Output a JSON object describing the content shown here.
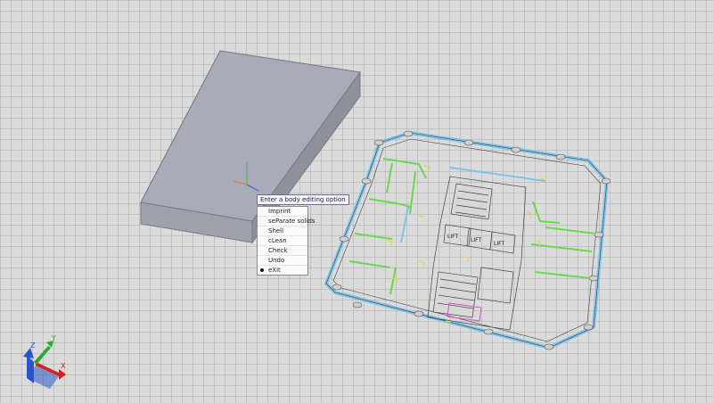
{
  "context_menu": {
    "title": "Enter a body editing option",
    "items": [
      {
        "label": "Imprint",
        "selected": false
      },
      {
        "label": "seParate solids",
        "selected": false
      },
      {
        "label": "Shell",
        "selected": false
      },
      {
        "label": "cLean",
        "selected": false
      },
      {
        "label": "Check",
        "selected": false
      },
      {
        "label": "Undo",
        "selected": false
      },
      {
        "label": "eXit",
        "selected": true
      }
    ]
  },
  "floorplan": {
    "lift_labels": [
      "LIFT",
      "LIFT",
      "LIFT"
    ]
  },
  "ucs_axes": {
    "x_label": "X",
    "y_label": "Y",
    "z_label": "Z"
  },
  "colors": {
    "background": "#dadbda",
    "solid_top": "#a9acb8",
    "solid_front": "#9fa1ab",
    "solid_side": "#8e909a",
    "wall_blue": "#7fc3e8",
    "wall_green": "#6ad94f",
    "wall_yellow": "#e6d64a",
    "axis_x": "#d42020",
    "axis_y": "#2fa82f",
    "axis_z": "#2a55c8"
  }
}
